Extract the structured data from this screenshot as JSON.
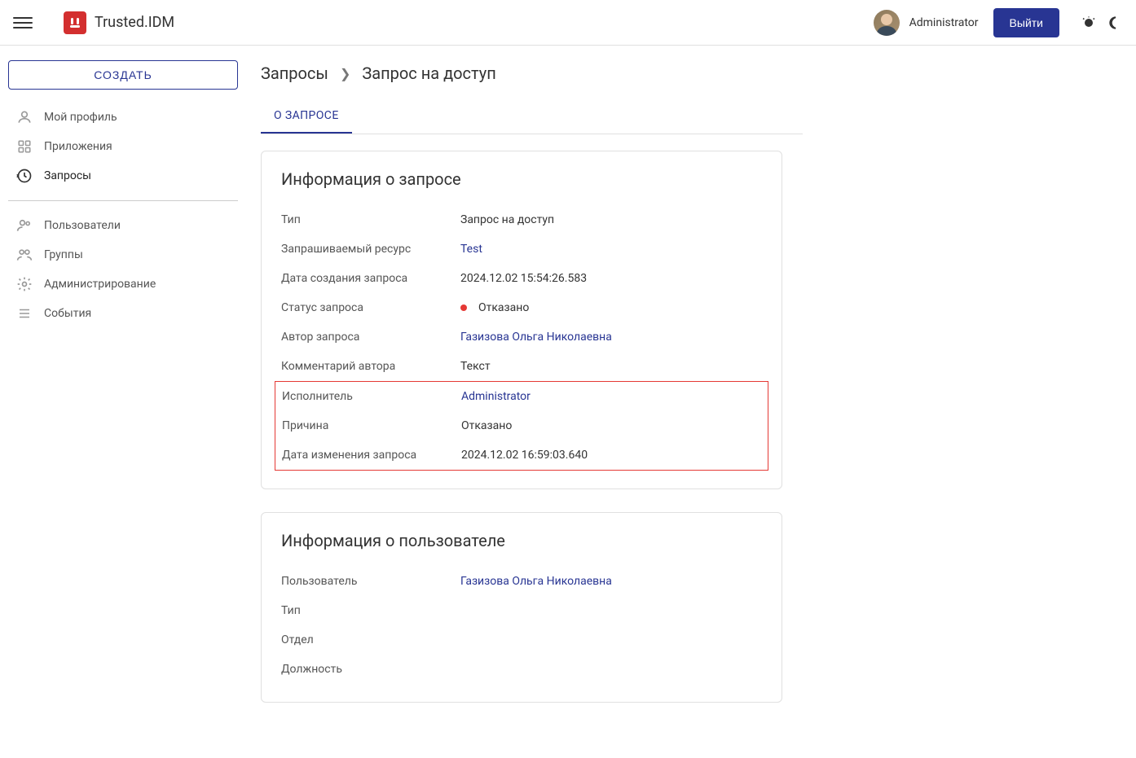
{
  "header": {
    "app_name": "Trusted.IDM",
    "user": "Administrator",
    "logout": "Выйти"
  },
  "sidebar": {
    "create": "СОЗДАТЬ",
    "items_top": [
      {
        "label": "Мой профиль"
      },
      {
        "label": "Приложения"
      },
      {
        "label": "Запросы"
      }
    ],
    "items_bottom": [
      {
        "label": "Пользователи"
      },
      {
        "label": "Группы"
      },
      {
        "label": "Администрирование"
      },
      {
        "label": "События"
      }
    ]
  },
  "breadcrumb": {
    "root": "Запросы",
    "current": "Запрос на доступ"
  },
  "tabs": {
    "about": "О ЗАПРОСЕ"
  },
  "request_card": {
    "title": "Информация о запросе",
    "rows": {
      "type_label": "Тип",
      "type_value": "Запрос на доступ",
      "resource_label": "Запрашиваемый ресурс",
      "resource_value": "Test",
      "created_label": "Дата создания запроса",
      "created_value": "2024.12.02 15:54:26.583",
      "status_label": "Статус запроса",
      "status_value": "Отказано",
      "author_label": "Автор запроса",
      "author_value": "Газизова Ольга Николаевна",
      "comment_label": "Комментарий автора",
      "comment_value": "Текст",
      "executor_label": "Исполнитель",
      "executor_value": "Administrator",
      "reason_label": "Причина",
      "reason_value": "Отказано",
      "modified_label": "Дата изменения запроса",
      "modified_value": "2024.12.02 16:59:03.640"
    }
  },
  "user_card": {
    "title": "Информация о пользователе",
    "rows": {
      "user_label": "Пользователь",
      "user_value": "Газизова Ольга Николаевна",
      "type_label": "Тип",
      "type_value": "",
      "dept_label": "Отдел",
      "dept_value": "",
      "position_label": "Должность",
      "position_value": ""
    }
  }
}
